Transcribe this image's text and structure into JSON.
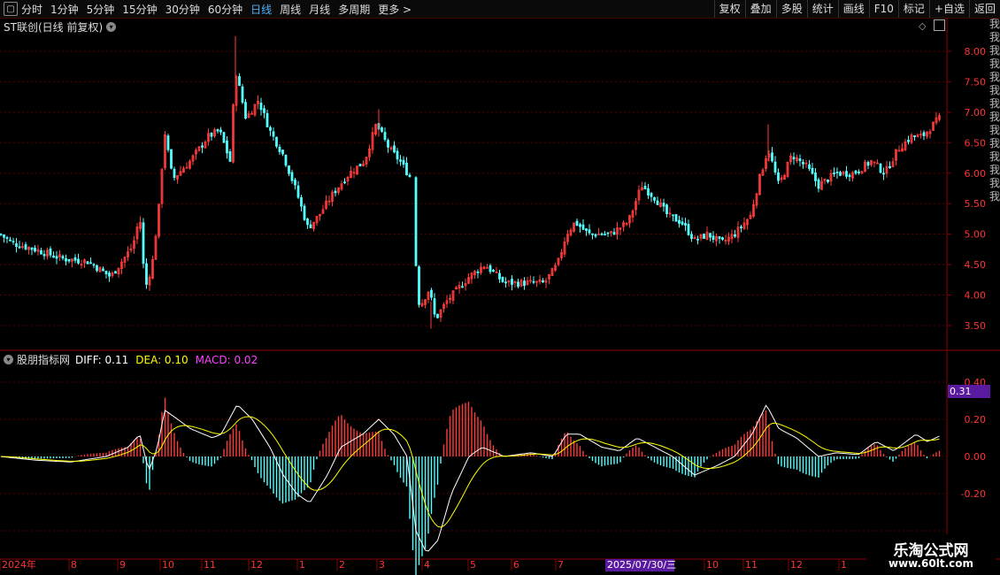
{
  "toolbar": {
    "periods": [
      "分时",
      "1分钟",
      "5分钟",
      "15分钟",
      "30分钟",
      "60分钟",
      "日线",
      "周线",
      "月线",
      "多周期",
      "更多 >"
    ],
    "active_period": "日线",
    "buttons": [
      "复权",
      "叠加",
      "多股",
      "统计",
      "画线",
      "F10",
      "标记",
      "+自选",
      "返回"
    ]
  },
  "price_panel": {
    "title": "ST联创(日线 前复权)",
    "y_labels": [
      "8.00",
      "7.50",
      "7.00",
      "6.50",
      "6.00",
      "5.50",
      "5.00",
      "4.50",
      "4.00",
      "3.50"
    ]
  },
  "macd_panel": {
    "indicator_name": "股朋指标网",
    "diff_text": "DIFF: 0.11",
    "dea_text": "DEA: 0.10",
    "macd_text": "MACD: 0.02",
    "y_labels": [
      "0.40",
      "0.20",
      "0.00",
      "-0.20"
    ],
    "current_value": "0.31"
  },
  "x_axis": {
    "labels": [
      "2024年",
      "8",
      "9",
      "10",
      "11",
      "12",
      "1",
      "2",
      "3",
      "4",
      "5",
      "6",
      "7",
      "10",
      "11",
      "12",
      "1"
    ],
    "cursor_date": "2025/07/30/三"
  },
  "side_strip_text": "我我我我我我我我我我我我我我",
  "watermark": {
    "line1": "乐淘公式网",
    "line2": "www.60lt.com"
  },
  "colors": {
    "up": "#ff3b3b",
    "down": "#54ffff",
    "diff": "#ffffff",
    "dea": "#ffff00",
    "macd_label": "#ff40ff",
    "grid": "#5a0000",
    "axis_label": "#ff3333"
  }
}
